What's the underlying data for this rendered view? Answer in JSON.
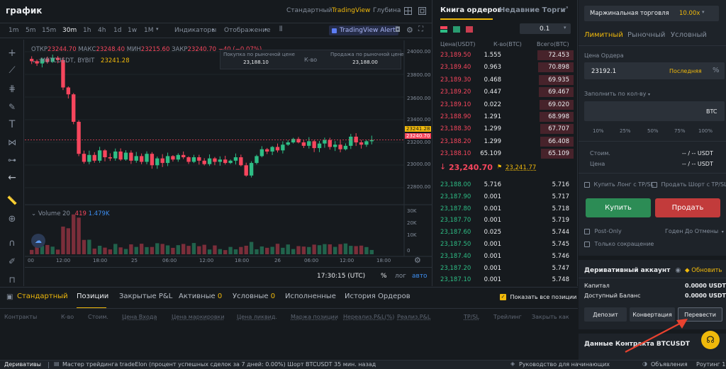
{
  "header": {
    "title": "график",
    "view_tabs": [
      "Стандартный",
      "TradingView",
      "Глубина"
    ],
    "active_view": "TradingView"
  },
  "chart_toolbar": {
    "intervals": [
      "1m",
      "5m",
      "15m",
      "30m",
      "1h",
      "4h",
      "1d",
      "1w",
      "1M"
    ],
    "active_interval": "30m",
    "indicators_label": "Индикаторы",
    "display_label": "Отображение",
    "alert_label": "TradingView Alert"
  },
  "chart_legend": {
    "o_label": "ОТКР",
    "o_val": "23244.70",
    "h_label": "МАКС",
    "h_val": "23248.40",
    "l_label": "МИН",
    "l_val": "23215.60",
    "c_label": "ЗАКР",
    "c_val": "23240.70",
    "change": "−40 (−0.07%)",
    "symbol": ":MBTCUSDT, BYBIT",
    "price_tag": "23241.28",
    "volume_label": "Volume 20",
    "volume_val1": "419",
    "volume_val2": "1.479K"
  },
  "order_widget": {
    "buy_label": "Покупка по рыночной цене",
    "buy_price": "23,188.10",
    "qty_label": "К-во",
    "sell_label": "Продажа по рыночной цене",
    "sell_price": "23,188.00"
  },
  "price_axis": {
    "ticks": [
      "24000.00",
      "23800.00",
      "23600.00",
      "23400.00",
      "23200.00",
      "23000.00",
      "22800.00"
    ],
    "tag1": "23241.28",
    "tag2": "23240.70",
    "vol_ticks": [
      "30K",
      "20K",
      "10K",
      "0"
    ]
  },
  "time_axis": {
    "ticks": [
      "00",
      "12:00",
      "18:00",
      "25",
      "06:00",
      "12:00",
      "18:00",
      "26",
      "06:00",
      "12:00",
      "18:00"
    ],
    "clock": "17:30:15 (UTC)",
    "pct": "%",
    "log": "лог",
    "auto": "авто"
  },
  "chart_data": {
    "type": "candlestick",
    "symbol": ":MBTCUSDT, BYBIT",
    "interval": "30m",
    "ylim": [
      22700,
      24050
    ],
    "close_series": [
      23930,
      23910,
      23950,
      23925,
      23960,
      23940,
      23700,
      23640,
      23400,
      23120,
      23050,
      23110,
      23060,
      23150,
      23090,
      23080,
      23140,
      23070,
      23130,
      23060,
      23100,
      23050,
      23120,
      23020,
      23080,
      23040,
      23100,
      23070,
      23110,
      23090,
      23050,
      23090,
      23060,
      23030,
      23080,
      23050,
      23070,
      23040,
      23060,
      23090,
      23020,
      22930,
      23040,
      23100,
      23160,
      23140,
      23180,
      23150,
      23200,
      23220,
      23250,
      23220,
      23190,
      23230,
      23170,
      23210,
      23240,
      23180,
      23200,
      23160,
      23190,
      23270,
      23220,
      23200,
      23230,
      23241
    ]
  },
  "order_book": {
    "tabs": [
      "Книга ордеров",
      "Недавние Торги"
    ],
    "active_tab": "Книга ордеров",
    "step": "0.1",
    "headers": [
      "Цена(USDT)",
      "К-во(BTC)",
      "Всего(BTC)"
    ],
    "asks": [
      {
        "price": "23,189.50",
        "qty": "1.555",
        "total": "72.453",
        "depth": 0.98
      },
      {
        "price": "23,189.40",
        "qty": "0.963",
        "total": "70.898",
        "depth": 0.96
      },
      {
        "price": "23,189.30",
        "qty": "0.468",
        "total": "69.935",
        "depth": 0.95
      },
      {
        "price": "23,189.20",
        "qty": "0.447",
        "total": "69.467",
        "depth": 0.94
      },
      {
        "price": "23,189.10",
        "qty": "0.022",
        "total": "69.020",
        "depth": 0.93
      },
      {
        "price": "23,188.90",
        "qty": "1.291",
        "total": "68.998",
        "depth": 0.93
      },
      {
        "price": "23,188.30",
        "qty": "1.299",
        "total": "67.707",
        "depth": 0.91
      },
      {
        "price": "23,188.20",
        "qty": "1.299",
        "total": "66.408",
        "depth": 0.9
      },
      {
        "price": "23,188.10",
        "qty": "65.109",
        "total": "65.109",
        "depth": 0.88
      }
    ],
    "last_price": "23,240.70",
    "mark_price": "23,241.77",
    "bids": [
      {
        "price": "23,188.00",
        "qty": "5.716",
        "total": "5.716"
      },
      {
        "price": "23,187.90",
        "qty": "0.001",
        "total": "5.717"
      },
      {
        "price": "23,187.80",
        "qty": "0.001",
        "total": "5.718"
      },
      {
        "price": "23,187.70",
        "qty": "0.001",
        "total": "5.719"
      },
      {
        "price": "23,187.60",
        "qty": "0.025",
        "total": "5.744"
      },
      {
        "price": "23,187.50",
        "qty": "0.001",
        "total": "5.745"
      },
      {
        "price": "23,187.40",
        "qty": "0.001",
        "total": "5.746"
      },
      {
        "price": "23,187.20",
        "qty": "0.001",
        "total": "5.747"
      },
      {
        "price": "23,187.10",
        "qty": "0.001",
        "total": "5.748"
      }
    ]
  },
  "trade_panel": {
    "margin_label": "Маржинальная торговля",
    "leverage": "10.00x",
    "order_tabs": [
      "Лимитный",
      "Рыночный",
      "Условный"
    ],
    "active_order_tab": "Лимитный",
    "price_label": "Цена Ордера",
    "price_value": "23192.1",
    "last_label": "Последняя",
    "fill_label": "Заполнить по кол-ву",
    "qty_unit": "BTC",
    "percents": [
      "10%",
      "25%",
      "50%",
      "75%",
      "100%"
    ],
    "cost_label": "Стоим.",
    "cost_value": "-- / -- USDT",
    "price2_label": "Цена",
    "price2_value": "-- / -- USDT",
    "tp_long": "Купить Лонг с TP/SL",
    "tp_short": "Продать Шорт с TP/SL",
    "buy_btn": "Купить",
    "sell_btn": "Продать",
    "post_only": "Post-Only",
    "tif": "Годен До Отмены",
    "reduce_only": "Только сокращение"
  },
  "account": {
    "title": "Деривативный аккаунт",
    "refresh": "Обновить",
    "capital_label": "Капитал",
    "capital_value": "0.0000 USDT",
    "avail_label": "Доступный Баланс",
    "avail_value": "0.0000 USDT",
    "deposit_btn": "Депозит",
    "convert_btn": "Конвертация",
    "transfer_btn": "Перевести",
    "contract_title": "Данные Контракта BTCUSDT"
  },
  "positions": {
    "tabs": [
      {
        "label": "Стандартный",
        "count": ""
      },
      {
        "label": "Позиции",
        "count": ""
      },
      {
        "label": "Закрытые P&L",
        "count": ""
      },
      {
        "label": "Активные",
        "count": "0"
      },
      {
        "label": "Условные",
        "count": "0"
      },
      {
        "label": "Исполненные",
        "count": ""
      },
      {
        "label": "История Ордеров",
        "count": ""
      }
    ],
    "show_all": "Показать все позиции",
    "columns": [
      "Контракты",
      "К-во",
      "Стоим.",
      "Цена Входа",
      "Цена маркировки",
      "Цена ликвид.",
      "Маржа позиции",
      "Нереализ.P&L(%)",
      "Реализ.P&L",
      "TP/SL",
      "Трейлинг",
      "Закрыть как"
    ]
  },
  "status_bar": {
    "left": "Деривативы",
    "ticker": "Мастер трейдинга tradeElon (процент успешных сделок за 7 дней: 0.00%) Шорт BTCUSDT 35 мин. назад",
    "guide": "Руководство для начинающих",
    "news": "Объявления",
    "route": "Роутинг 1"
  },
  "colors": {
    "bg": "#161a1e",
    "panel": "#1e2329",
    "up": "#2ebd85",
    "down": "#f6465d",
    "accent": "#f0b90b",
    "arrow": "#e8422f"
  }
}
